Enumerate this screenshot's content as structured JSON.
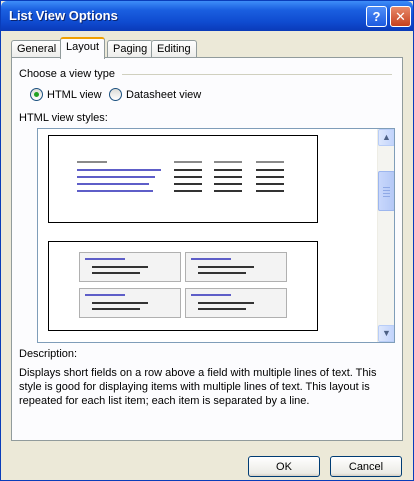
{
  "window": {
    "title": "List View Options",
    "help_glyph": "?",
    "close_glyph": "✕"
  },
  "tabs": [
    {
      "label": "General"
    },
    {
      "label": "Layout"
    },
    {
      "label": "Paging"
    },
    {
      "label": "Editing"
    }
  ],
  "view_type": {
    "legend": "Choose a view type",
    "options": [
      {
        "label": "HTML view",
        "checked": true
      },
      {
        "label": "Datasheet view",
        "checked": false
      }
    ]
  },
  "styles": {
    "label": "HTML view styles:",
    "scroll_up": "▲",
    "scroll_down": "▼"
  },
  "description": {
    "label": "Description:",
    "text": "Displays short fields on a row above a field with multiple lines of text. This style is good for displaying items with multiple lines of text. This layout is repeated for each list item; each item is separated by a line."
  },
  "buttons": {
    "ok": "OK",
    "cancel": "Cancel"
  },
  "colors": {
    "titlebar": "#0f4bd0",
    "dialog_bg": "#ece9d8",
    "preview_link": "#5e5ec8"
  }
}
